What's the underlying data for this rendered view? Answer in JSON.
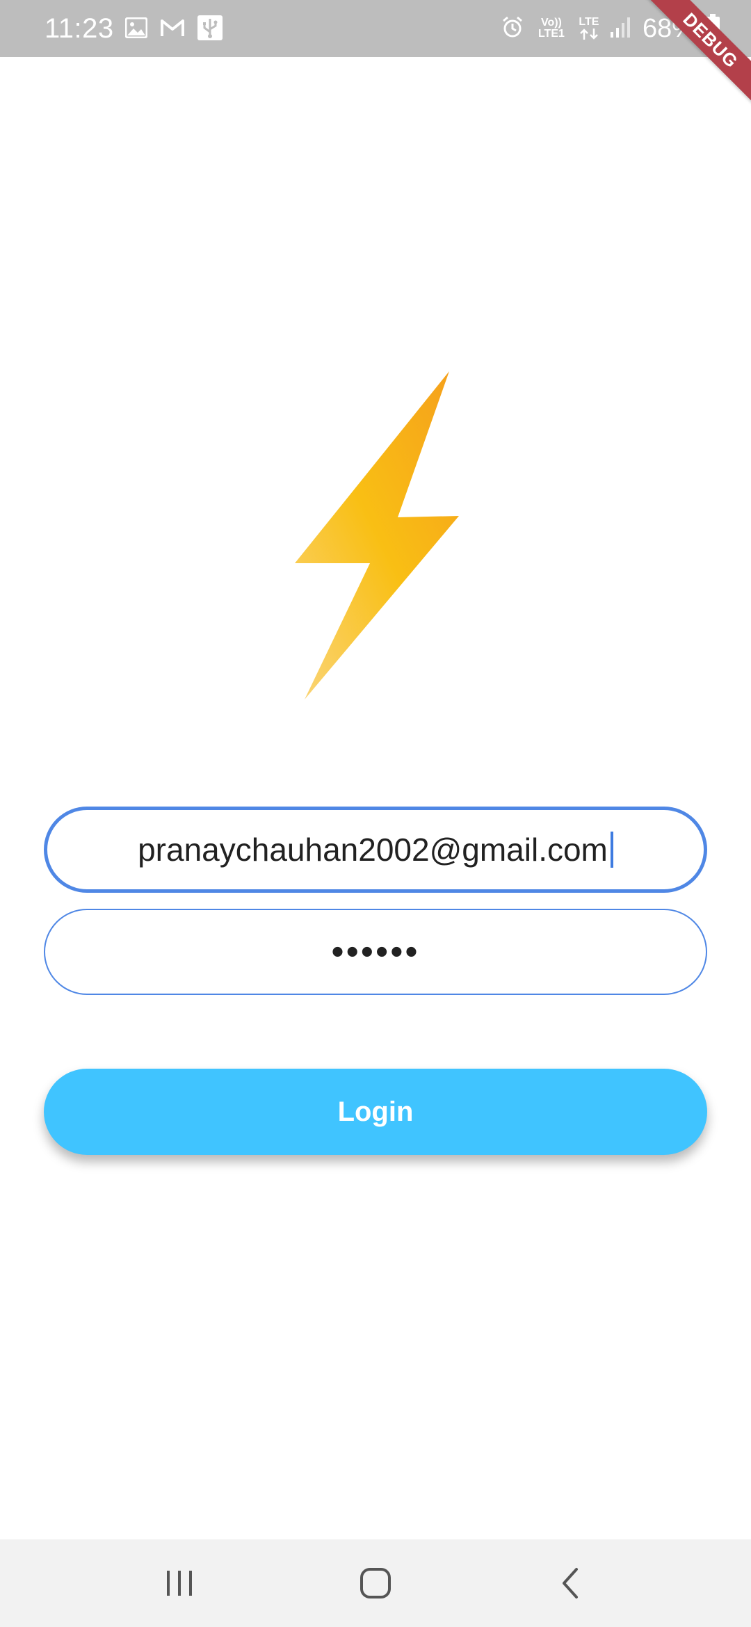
{
  "status_bar": {
    "time": "11:23",
    "battery": "68%",
    "network_volte": "Vo)) LTE1",
    "network_lte": "LTE",
    "icons": [
      "gallery-icon",
      "gmail-icon",
      "usb-icon",
      "alarm-icon",
      "signal-icon",
      "battery-icon"
    ]
  },
  "debug_banner": {
    "label": "DEBUG",
    "color": "#b3404a"
  },
  "logo": {
    "icon": "lightning-bolt-icon",
    "colors": [
      "#f59f1c",
      "#f9bf14",
      "#fad57a"
    ]
  },
  "login_form": {
    "email_value": "pranaychauhan2002@gmail.com",
    "password_value": "••••••",
    "login_label": "Login",
    "accent_color": "#4f87e5",
    "button_color": "#40c4ff"
  },
  "nav_bar": {
    "buttons": [
      "recent-apps-icon",
      "home-icon",
      "back-icon"
    ]
  }
}
